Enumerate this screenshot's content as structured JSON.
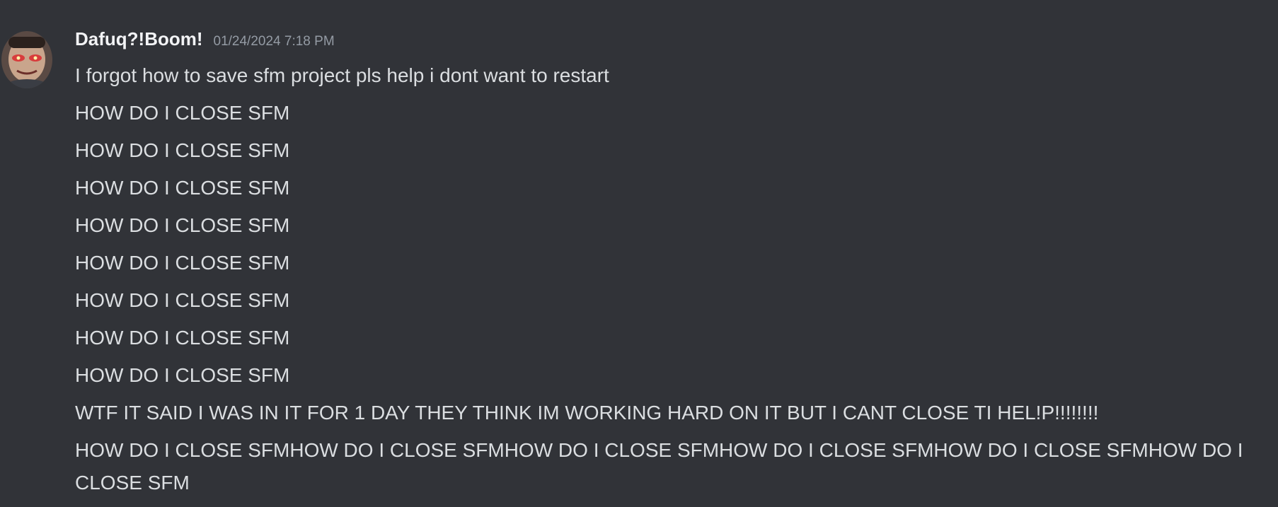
{
  "message": {
    "author": "Dafuq?!Boom!",
    "timestamp": "01/24/2024 7:18 PM",
    "avatar_icon": "avatar-face-icon",
    "lines": [
      "I forgot how to save sfm project pls help i dont want to restart",
      "HOW DO I CLOSE SFM",
      "HOW DO I CLOSE SFM",
      "HOW DO I CLOSE SFM",
      "HOW DO I CLOSE SFM",
      "HOW DO I CLOSE SFM",
      "HOW DO I CLOSE SFM",
      "HOW DO I CLOSE SFM",
      "HOW DO I CLOSE SFM",
      "WTF IT SAID I WAS IN IT FOR 1 DAY THEY THINK IM WORKING HARD ON IT BUT I CANT CLOSE TI HEL!P!!!!!!!!",
      "HOW DO I CLOSE SFMHOW DO I CLOSE SFMHOW DO I CLOSE SFMHOW DO I CLOSE SFMHOW DO I CLOSE SFMHOW DO I CLOSE SFM"
    ]
  },
  "colors": {
    "background": "#313338",
    "text": "#dbdee1",
    "username": "#f2f3f5",
    "timestamp": "#949ba4"
  }
}
